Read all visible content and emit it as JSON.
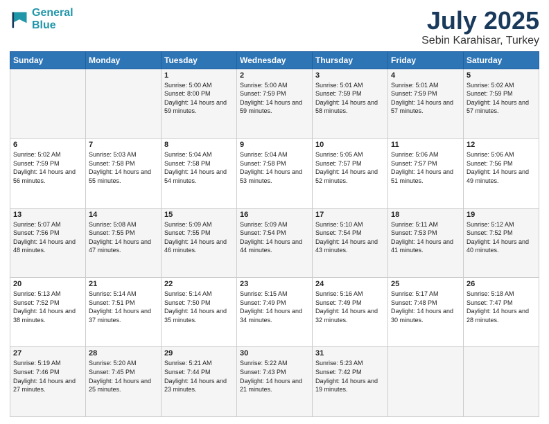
{
  "logo": {
    "line1": "General",
    "line2": "Blue"
  },
  "title": {
    "month": "July 2025",
    "location": "Sebin Karahisar, Turkey"
  },
  "weekdays": [
    "Sunday",
    "Monday",
    "Tuesday",
    "Wednesday",
    "Thursday",
    "Friday",
    "Saturday"
  ],
  "weeks": [
    [
      {
        "day": "",
        "info": ""
      },
      {
        "day": "",
        "info": ""
      },
      {
        "day": "1",
        "info": "Sunrise: 5:00 AM\nSunset: 8:00 PM\nDaylight: 14 hours\nand 59 minutes."
      },
      {
        "day": "2",
        "info": "Sunrise: 5:00 AM\nSunset: 7:59 PM\nDaylight: 14 hours\nand 59 minutes."
      },
      {
        "day": "3",
        "info": "Sunrise: 5:01 AM\nSunset: 7:59 PM\nDaylight: 14 hours\nand 58 minutes."
      },
      {
        "day": "4",
        "info": "Sunrise: 5:01 AM\nSunset: 7:59 PM\nDaylight: 14 hours\nand 57 minutes."
      },
      {
        "day": "5",
        "info": "Sunrise: 5:02 AM\nSunset: 7:59 PM\nDaylight: 14 hours\nand 57 minutes."
      }
    ],
    [
      {
        "day": "6",
        "info": "Sunrise: 5:02 AM\nSunset: 7:59 PM\nDaylight: 14 hours\nand 56 minutes."
      },
      {
        "day": "7",
        "info": "Sunrise: 5:03 AM\nSunset: 7:58 PM\nDaylight: 14 hours\nand 55 minutes."
      },
      {
        "day": "8",
        "info": "Sunrise: 5:04 AM\nSunset: 7:58 PM\nDaylight: 14 hours\nand 54 minutes."
      },
      {
        "day": "9",
        "info": "Sunrise: 5:04 AM\nSunset: 7:58 PM\nDaylight: 14 hours\nand 53 minutes."
      },
      {
        "day": "10",
        "info": "Sunrise: 5:05 AM\nSunset: 7:57 PM\nDaylight: 14 hours\nand 52 minutes."
      },
      {
        "day": "11",
        "info": "Sunrise: 5:06 AM\nSunset: 7:57 PM\nDaylight: 14 hours\nand 51 minutes."
      },
      {
        "day": "12",
        "info": "Sunrise: 5:06 AM\nSunset: 7:56 PM\nDaylight: 14 hours\nand 49 minutes."
      }
    ],
    [
      {
        "day": "13",
        "info": "Sunrise: 5:07 AM\nSunset: 7:56 PM\nDaylight: 14 hours\nand 48 minutes."
      },
      {
        "day": "14",
        "info": "Sunrise: 5:08 AM\nSunset: 7:55 PM\nDaylight: 14 hours\nand 47 minutes."
      },
      {
        "day": "15",
        "info": "Sunrise: 5:09 AM\nSunset: 7:55 PM\nDaylight: 14 hours\nand 46 minutes."
      },
      {
        "day": "16",
        "info": "Sunrise: 5:09 AM\nSunset: 7:54 PM\nDaylight: 14 hours\nand 44 minutes."
      },
      {
        "day": "17",
        "info": "Sunrise: 5:10 AM\nSunset: 7:54 PM\nDaylight: 14 hours\nand 43 minutes."
      },
      {
        "day": "18",
        "info": "Sunrise: 5:11 AM\nSunset: 7:53 PM\nDaylight: 14 hours\nand 41 minutes."
      },
      {
        "day": "19",
        "info": "Sunrise: 5:12 AM\nSunset: 7:52 PM\nDaylight: 14 hours\nand 40 minutes."
      }
    ],
    [
      {
        "day": "20",
        "info": "Sunrise: 5:13 AM\nSunset: 7:52 PM\nDaylight: 14 hours\nand 38 minutes."
      },
      {
        "day": "21",
        "info": "Sunrise: 5:14 AM\nSunset: 7:51 PM\nDaylight: 14 hours\nand 37 minutes."
      },
      {
        "day": "22",
        "info": "Sunrise: 5:14 AM\nSunset: 7:50 PM\nDaylight: 14 hours\nand 35 minutes."
      },
      {
        "day": "23",
        "info": "Sunrise: 5:15 AM\nSunset: 7:49 PM\nDaylight: 14 hours\nand 34 minutes."
      },
      {
        "day": "24",
        "info": "Sunrise: 5:16 AM\nSunset: 7:49 PM\nDaylight: 14 hours\nand 32 minutes."
      },
      {
        "day": "25",
        "info": "Sunrise: 5:17 AM\nSunset: 7:48 PM\nDaylight: 14 hours\nand 30 minutes."
      },
      {
        "day": "26",
        "info": "Sunrise: 5:18 AM\nSunset: 7:47 PM\nDaylight: 14 hours\nand 28 minutes."
      }
    ],
    [
      {
        "day": "27",
        "info": "Sunrise: 5:19 AM\nSunset: 7:46 PM\nDaylight: 14 hours\nand 27 minutes."
      },
      {
        "day": "28",
        "info": "Sunrise: 5:20 AM\nSunset: 7:45 PM\nDaylight: 14 hours\nand 25 minutes."
      },
      {
        "day": "29",
        "info": "Sunrise: 5:21 AM\nSunset: 7:44 PM\nDaylight: 14 hours\nand 23 minutes."
      },
      {
        "day": "30",
        "info": "Sunrise: 5:22 AM\nSunset: 7:43 PM\nDaylight: 14 hours\nand 21 minutes."
      },
      {
        "day": "31",
        "info": "Sunrise: 5:23 AM\nSunset: 7:42 PM\nDaylight: 14 hours\nand 19 minutes."
      },
      {
        "day": "",
        "info": ""
      },
      {
        "day": "",
        "info": ""
      }
    ]
  ]
}
